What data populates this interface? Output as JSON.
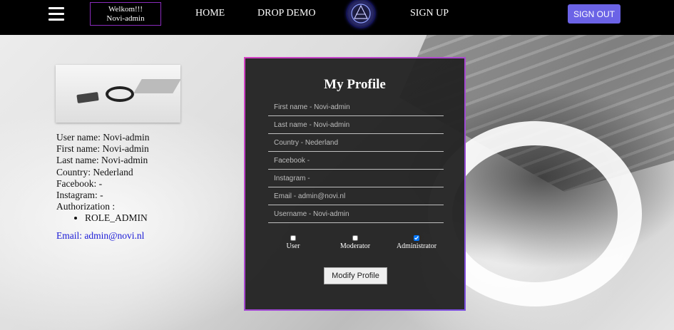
{
  "nav": {
    "welcome_line1": "Welkom!!!",
    "welcome_line2": "Novi-admin",
    "home": "HOME",
    "drop_demo": "DROP DEMO",
    "sign_up": "SIGN UP",
    "sign_out": "SIGN OUT",
    "accent": "#6b63e6"
  },
  "user_info": {
    "username": "User name: Novi-admin",
    "first_name": "First name: Novi-admin",
    "last_name": "Last name: Novi-admin",
    "country": "Country: Nederland",
    "facebook": "Facebook: -",
    "instagram": "Instagram: -",
    "authorization_label": "Authorization :",
    "roles": [
      "ROLE_ADMIN"
    ],
    "email": "Email: admin@novi.nl"
  },
  "profile_form": {
    "title": "My Profile",
    "fields": [
      {
        "placeholder": "First name - Novi-admin"
      },
      {
        "placeholder": "Last name - Novi-admin"
      },
      {
        "placeholder": "Country - Nederland"
      },
      {
        "placeholder": "Facebook -"
      },
      {
        "placeholder": "Instagram -"
      },
      {
        "placeholder": "Email - admin@novi.nl"
      },
      {
        "placeholder": "Username - Novi-admin"
      }
    ],
    "roles": [
      {
        "label": "User",
        "checked": false
      },
      {
        "label": "Moderator",
        "checked": false
      },
      {
        "label": "Administrator",
        "checked": true
      }
    ],
    "submit_label": "Modify Profile"
  }
}
